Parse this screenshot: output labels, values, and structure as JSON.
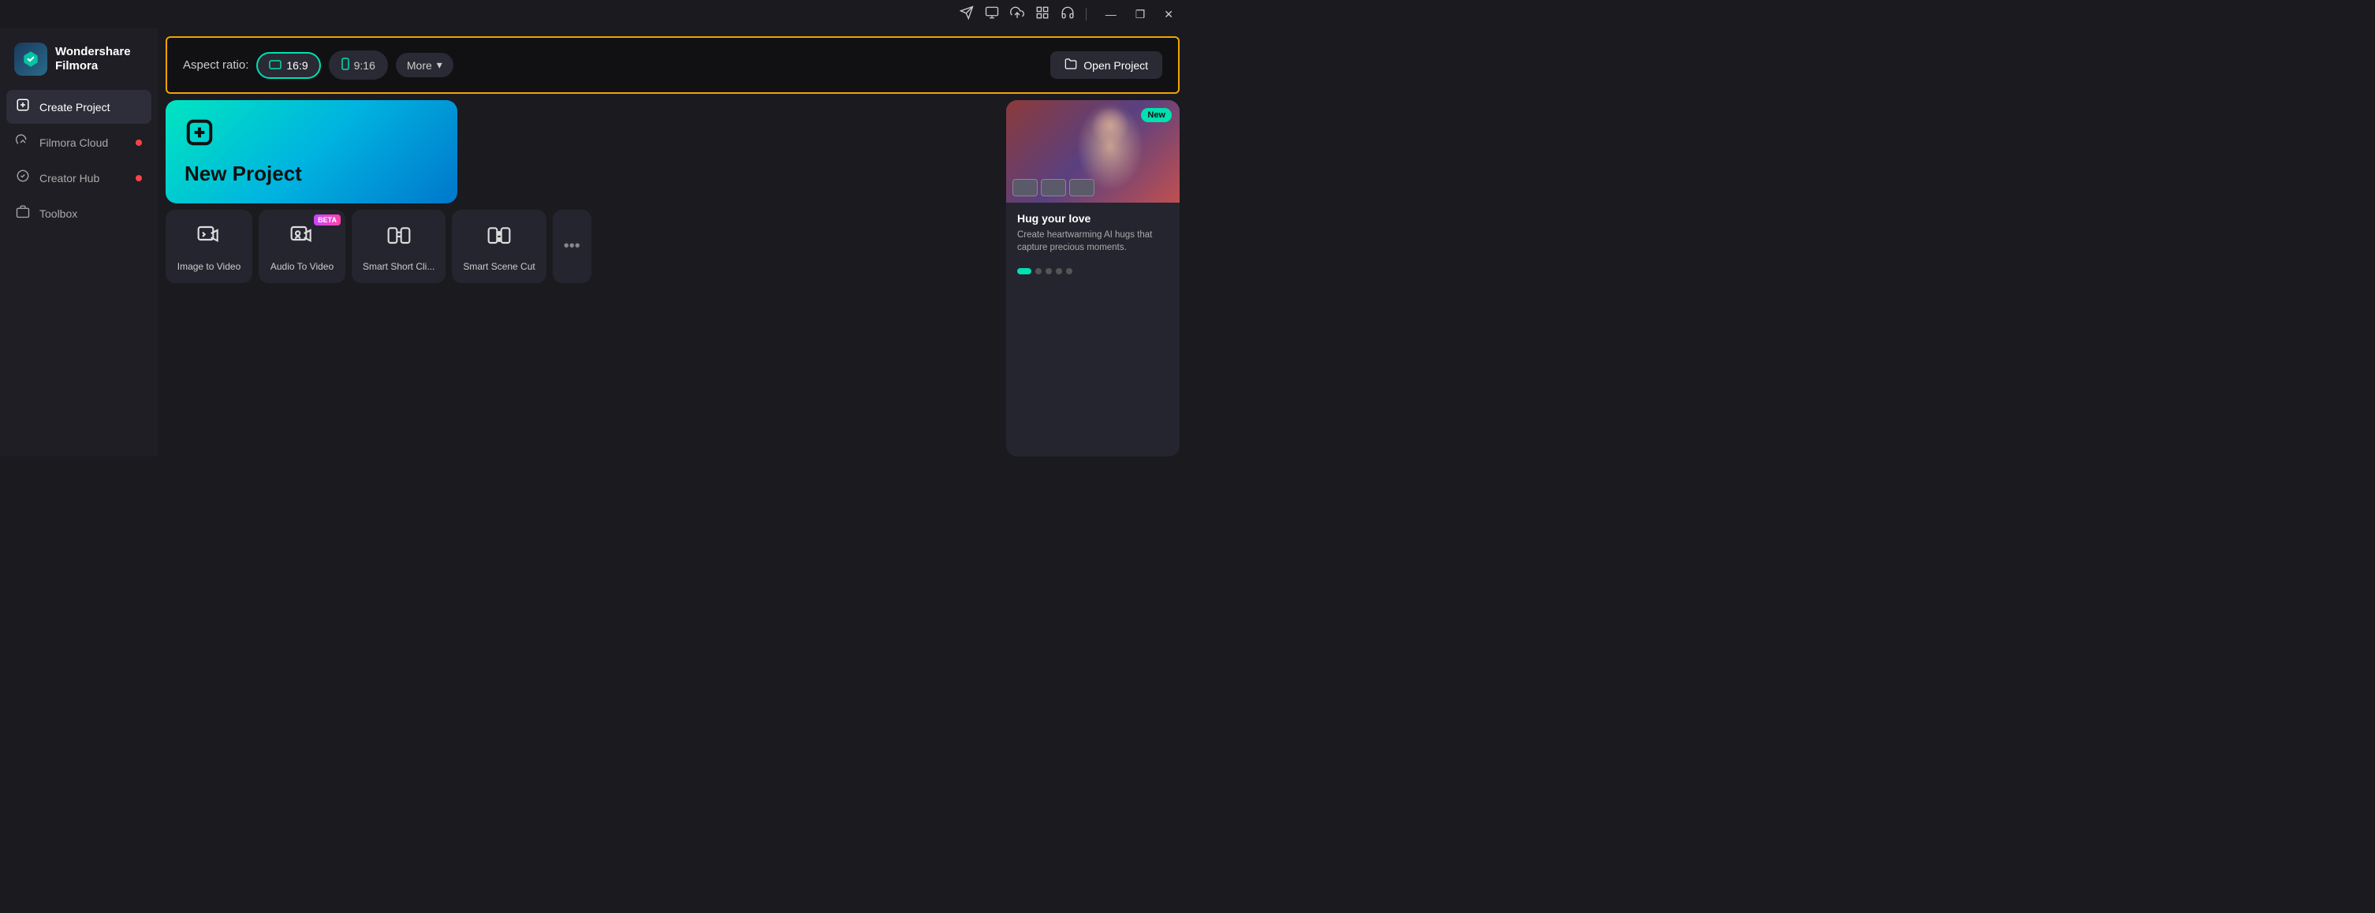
{
  "app": {
    "name": "Wondershare",
    "name2": "Filmora"
  },
  "titlebar": {
    "icons": [
      "send-icon",
      "screen-icon",
      "cloud-icon",
      "grid-icon",
      "headset-icon"
    ],
    "minimize": "—",
    "restore": "❐",
    "close": "✕"
  },
  "sidebar": {
    "items": [
      {
        "id": "create-project",
        "label": "Create Project",
        "icon": "➕",
        "active": true,
        "dot": false
      },
      {
        "id": "filmora-cloud",
        "label": "Filmora Cloud",
        "icon": "☁",
        "active": false,
        "dot": true
      },
      {
        "id": "creator-hub",
        "label": "Creator Hub",
        "icon": "💡",
        "active": false,
        "dot": true
      },
      {
        "id": "toolbox",
        "label": "Toolbox",
        "icon": "🗂",
        "active": false,
        "dot": false
      }
    ]
  },
  "topbar": {
    "aspect_ratio_label": "Aspect ratio:",
    "buttons": [
      {
        "id": "16-9",
        "label": "16:9",
        "active": true
      },
      {
        "id": "9-16",
        "label": "9:16",
        "active": false
      }
    ],
    "more_label": "More",
    "open_project_label": "Open Project"
  },
  "new_project": {
    "label": "New Project"
  },
  "tools": [
    {
      "id": "image-to-video",
      "label": "Image to Video",
      "beta": false
    },
    {
      "id": "audio-to-video",
      "label": "Audio To Video",
      "beta": true
    },
    {
      "id": "smart-short-clip",
      "label": "Smart Short Cli...",
      "beta": false
    },
    {
      "id": "smart-scene-cut",
      "label": "Smart Scene Cut",
      "beta": false
    }
  ],
  "feature_card": {
    "new_badge": "New",
    "title": "Hug your love",
    "description": "Create heartwarming AI hugs that capture precious moments.",
    "dots_count": 5,
    "active_dot": 0
  }
}
